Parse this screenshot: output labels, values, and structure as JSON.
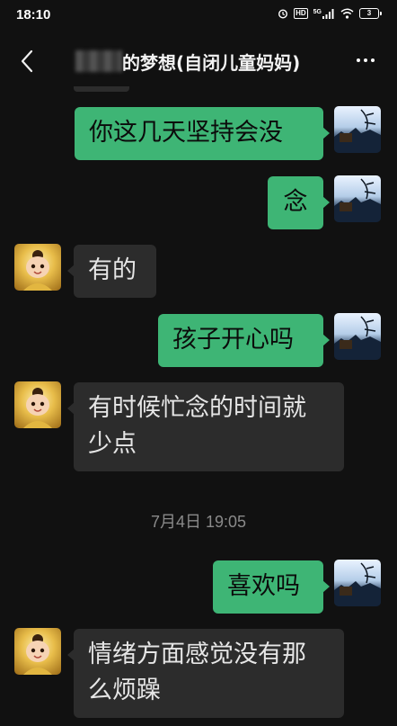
{
  "status_bar": {
    "time": "18:10",
    "hd_label": "HD",
    "network_label": "5G",
    "battery_level": "3"
  },
  "header": {
    "title": "的梦想(自闭儿童妈妈)"
  },
  "messages": [
    {
      "side": "out",
      "text": "你这几天坚持会没"
    },
    {
      "side": "out",
      "text": "念"
    },
    {
      "side": "in",
      "text": "有的"
    },
    {
      "side": "out",
      "text": "孩子开心吗"
    },
    {
      "side": "in",
      "text": "有时候忙念的时间就少点"
    },
    {
      "side": "out",
      "text": "喜欢吗"
    },
    {
      "side": "in",
      "text": "情绪方面感觉没有那么烦躁"
    }
  ],
  "timestamp": "7月4日 19:05",
  "colors": {
    "background": "#111111",
    "outgoing_bubble": "#3eb575",
    "incoming_bubble": "#2c2c2c",
    "timestamp_text": "#8a8a8a"
  }
}
